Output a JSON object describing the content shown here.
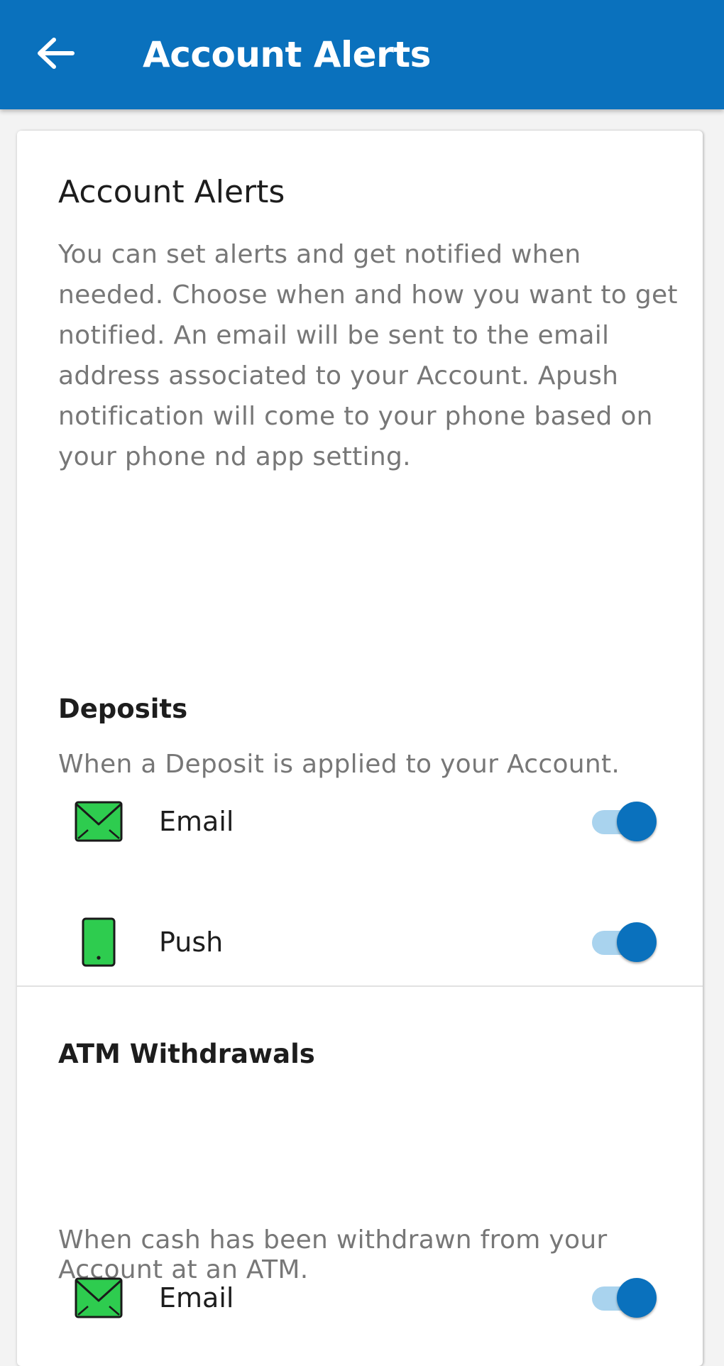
{
  "header": {
    "title": "Account Alerts",
    "back_icon": "arrow-left-icon",
    "background_color": "#0a71bd"
  },
  "intro": {
    "title": "Account Alerts",
    "description": "You can set alerts and get notified when needed. Choose when and how you want to get notified. An email will be sent to the email address associated to your Account. Apush notification will come to your phone based on your phone nd app setting."
  },
  "sections": [
    {
      "title": "Deposits",
      "description": "When a Deposit is applied to your Account.",
      "options": [
        {
          "label": "Email",
          "icon": "email-envelope-icon",
          "enabled": true
        },
        {
          "label": "Push",
          "icon": "phone-icon",
          "enabled": true
        }
      ]
    },
    {
      "title": "ATM Withdrawals",
      "description": "When cash has been withdrawn from your Account at an ATM.",
      "options": [
        {
          "label": "Email",
          "icon": "email-envelope-icon",
          "enabled": true
        }
      ]
    }
  ],
  "colors": {
    "accent": "#0a71bd",
    "toggle_track_on": "#a9d3ee",
    "icon_green": "#2ecc4f"
  }
}
